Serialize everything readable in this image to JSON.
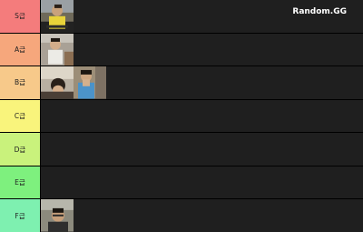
{
  "brand": "Random.GG",
  "tiers": [
    {
      "label": "S급",
      "color": "#f47c7c",
      "items": [
        "photo-boy-yellow-shirt"
      ]
    },
    {
      "label": "A급",
      "color": "#f6a77c",
      "items": [
        "photo-boy-white-shirt"
      ]
    },
    {
      "label": "B급",
      "color": "#f7c98a",
      "items": [
        "photo-boys-classroom",
        "photo-boy-blue-shirt"
      ]
    },
    {
      "label": "C급",
      "color": "#f9f47c",
      "items": []
    },
    {
      "label": "D급",
      "color": "#c9f27c",
      "items": []
    },
    {
      "label": "E급",
      "color": "#7ef07e",
      "items": []
    },
    {
      "label": "F급",
      "color": "#7ef0b0",
      "items": [
        "photo-boy-glasses"
      ]
    }
  ]
}
